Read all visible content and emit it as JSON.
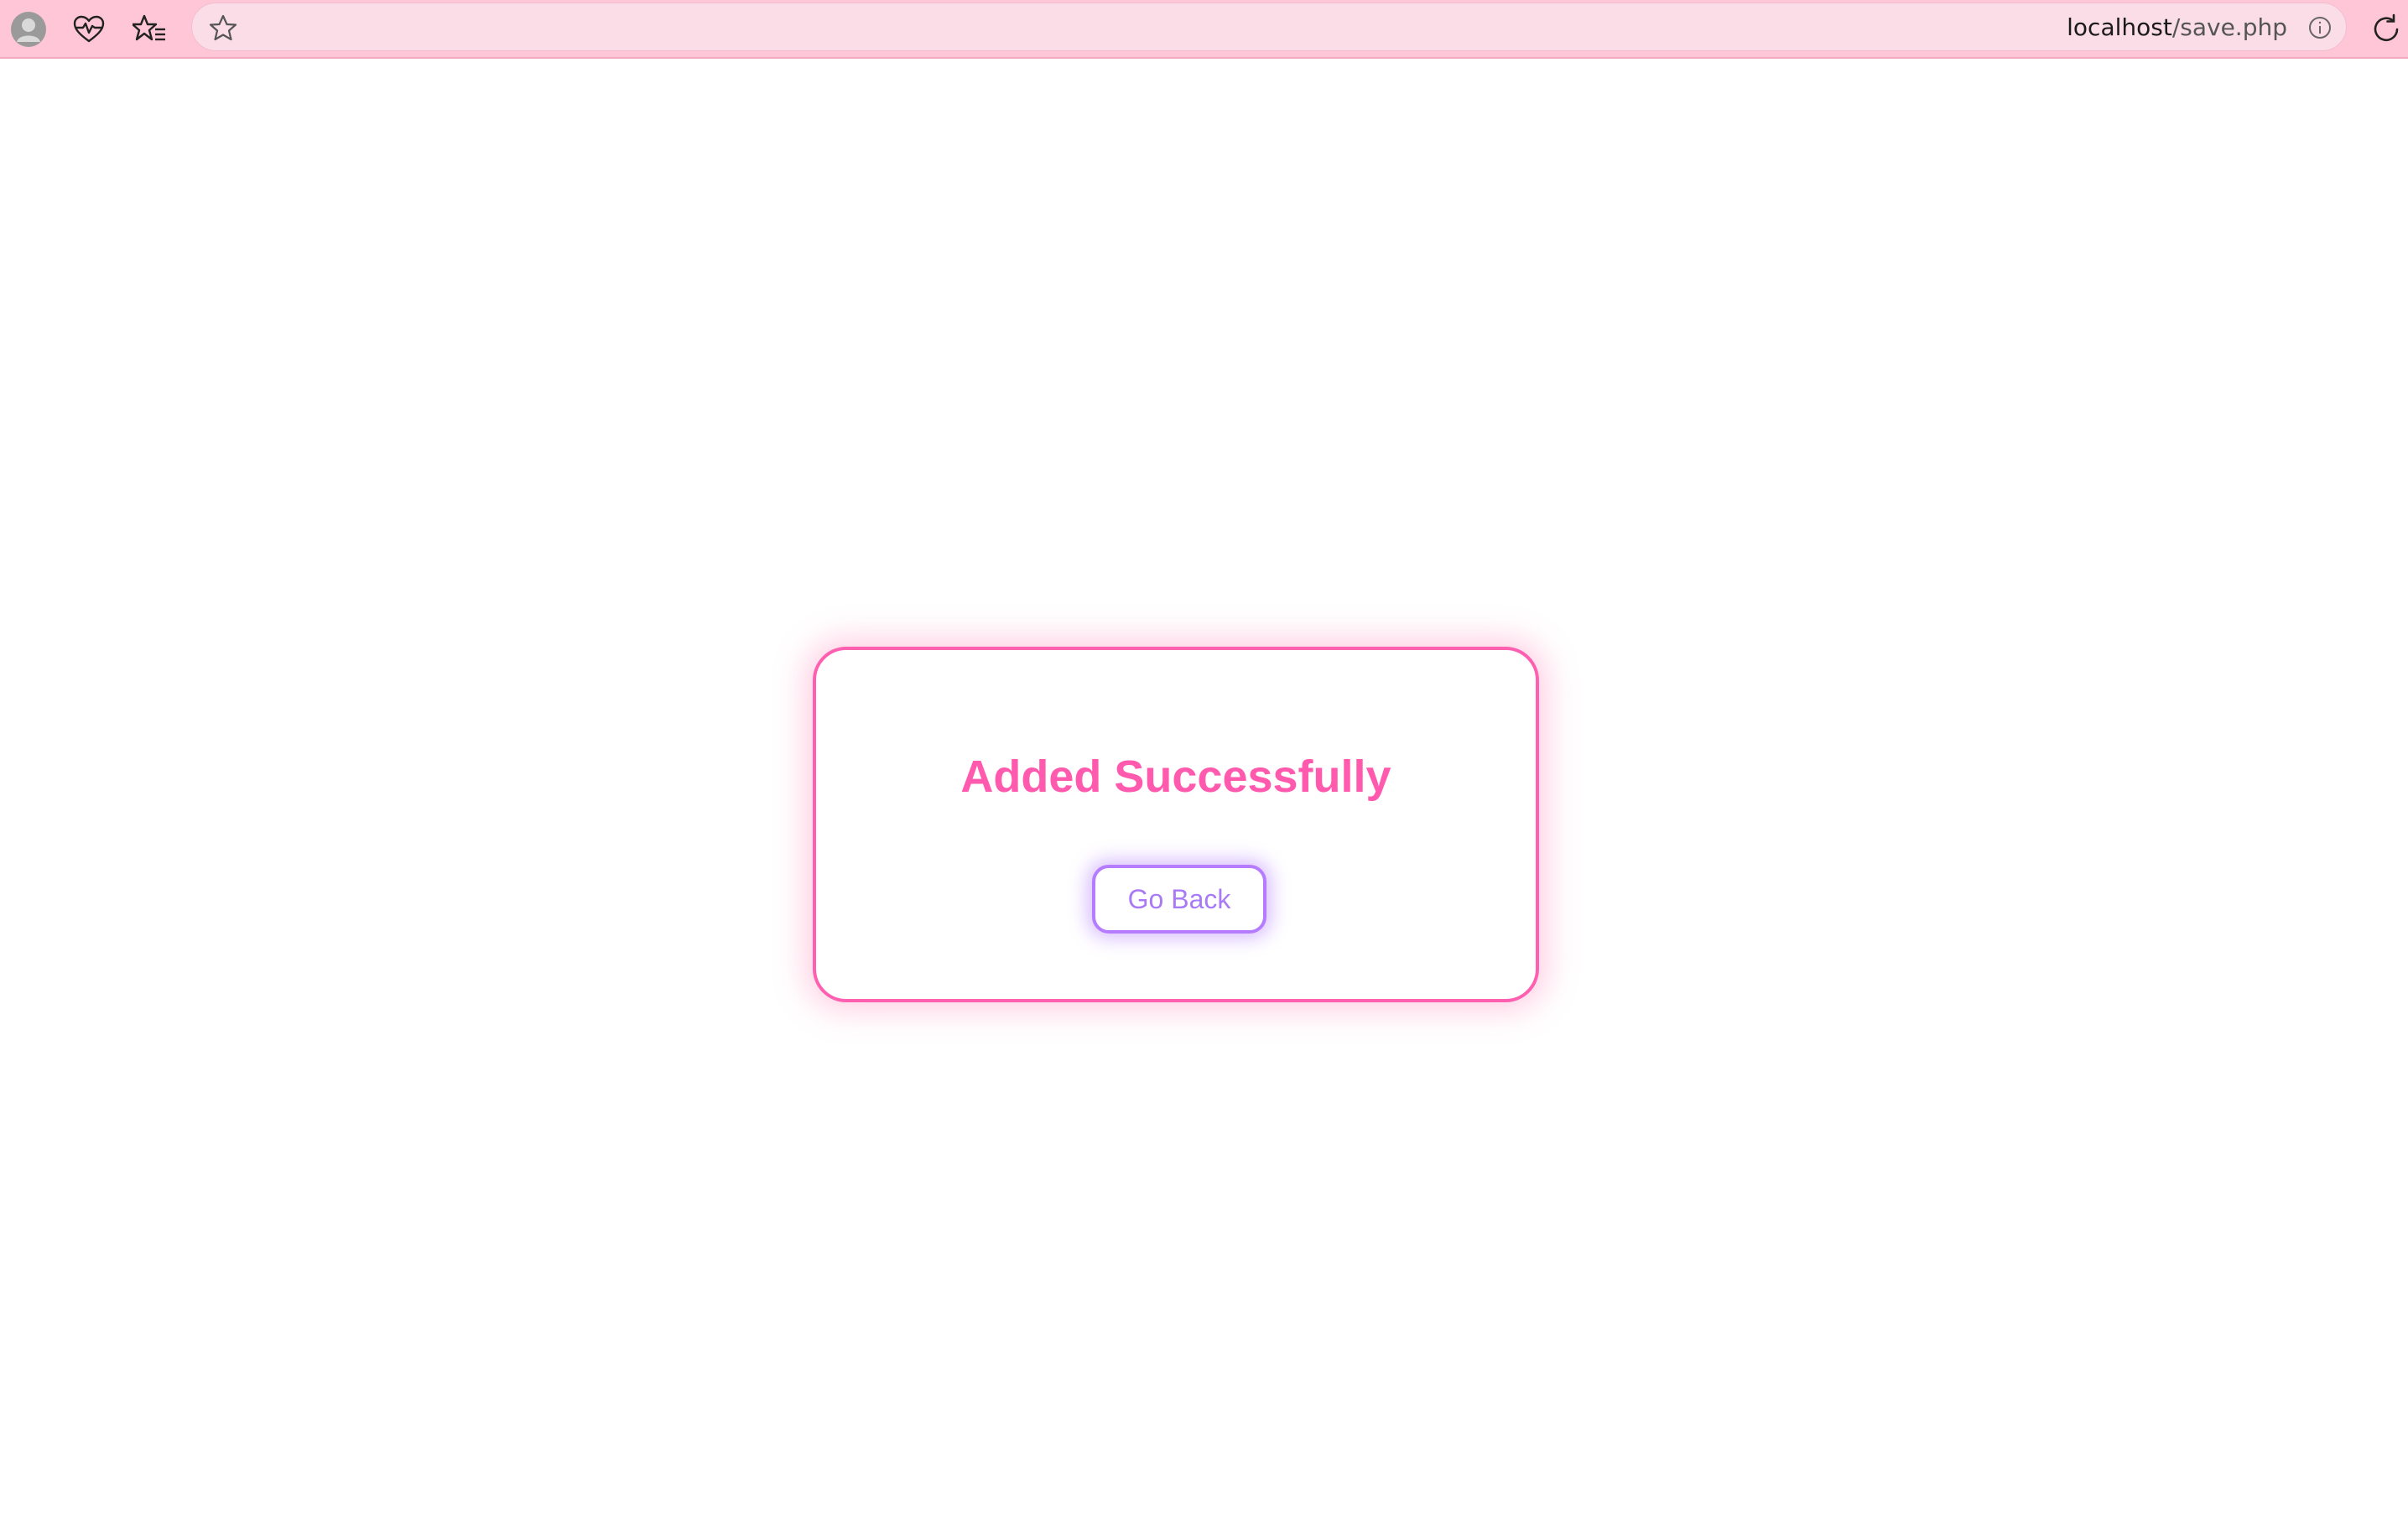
{
  "browser": {
    "icons": {
      "profile": "profile-avatar-icon",
      "health": "heartbeat-icon",
      "favorites": "favorites-list-icon",
      "bookmark": "star-icon",
      "site_info": "info-icon",
      "reload": "reload-icon"
    },
    "url": {
      "host": "localhost",
      "path": "/save.php"
    }
  },
  "message": {
    "title": "Added Successfully",
    "button_label": "Go Back"
  },
  "colors": {
    "toolbar_bg": "#ffc6d8",
    "card_border": "#ff5fb0",
    "title": "#ff5aae",
    "button_border": "#b57cff",
    "button_text": "#a97af5"
  }
}
